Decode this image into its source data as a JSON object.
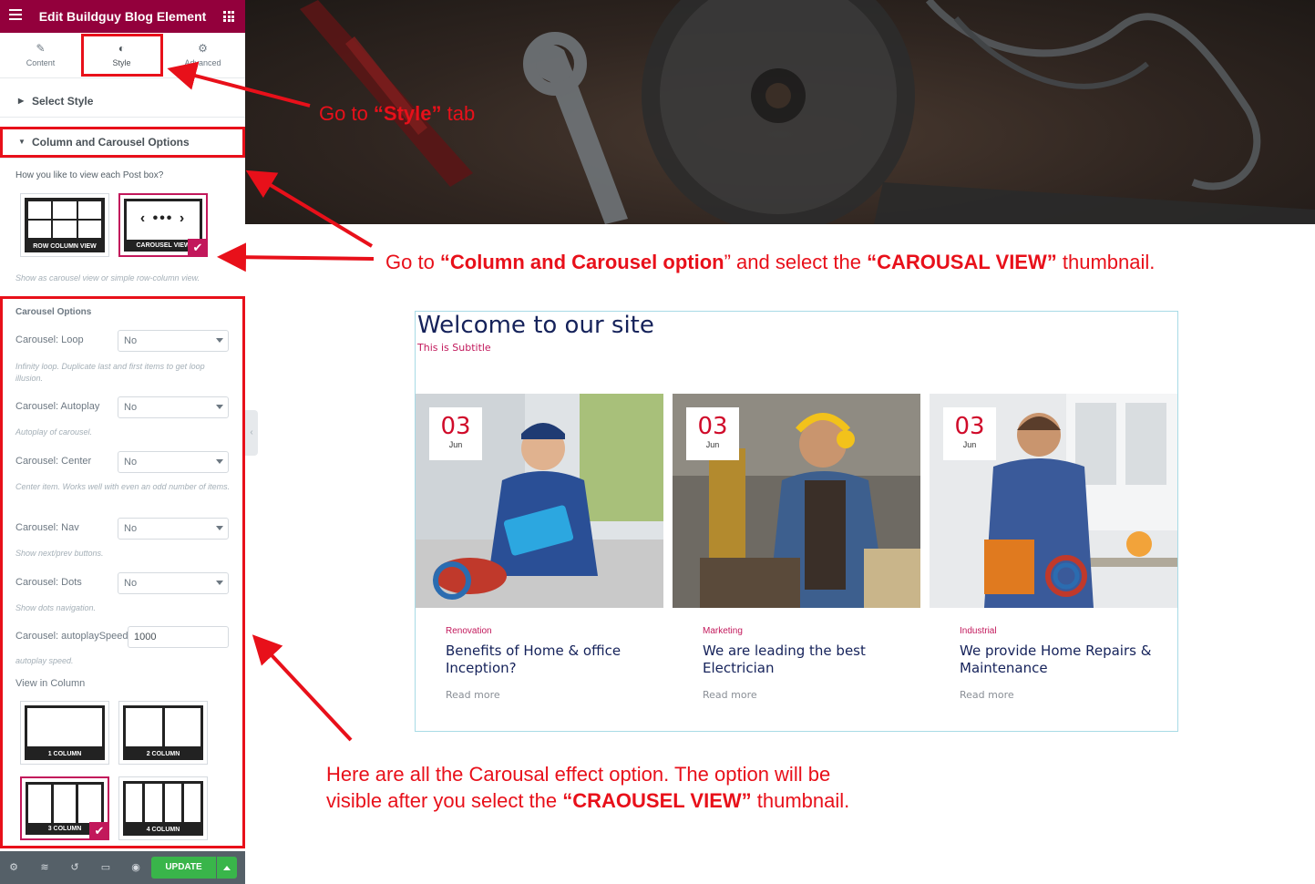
{
  "panel": {
    "title": "Edit Buildguy Blog Element",
    "tabs": [
      {
        "label": "Content",
        "icon": "pencil-icon"
      },
      {
        "label": "Style",
        "icon": "contrast-icon"
      },
      {
        "label": "Advanced",
        "icon": "gear-icon"
      }
    ],
    "active_tab": "Style",
    "sections": {
      "select_style": "Select Style",
      "column_carousel": "Column and Carousel Options"
    },
    "view_question": "How you like to view each Post box?",
    "view_options": [
      {
        "label": "ROW COLUMN VIEW",
        "selected": false
      },
      {
        "label": "CAROUSEL VIEW",
        "selected": true
      }
    ],
    "view_hint": "Show as carousel view or simple row-column view.",
    "carousel_heading": "Carousel Options",
    "controls": [
      {
        "label": "Carousel: Loop",
        "value": "No",
        "hint": "Infinity loop. Duplicate last and first items to get loop illusion."
      },
      {
        "label": "Carousel: Autoplay",
        "value": "No",
        "hint": "Autoplay of carousel."
      },
      {
        "label": "Carousel: Center",
        "value": "No",
        "hint": "Center item. Works well with even an odd number of items."
      },
      {
        "label": "Carousel: Nav",
        "value": "No",
        "hint": "Show next/prev buttons."
      },
      {
        "label": "Carousel: Dots",
        "value": "No",
        "hint": "Show dots navigation."
      }
    ],
    "autoplay_speed": {
      "label": "Carousel: autoplaySpeed",
      "value": "1000",
      "hint": "autoplay speed."
    },
    "view_in_column": "View in Column",
    "column_options": [
      {
        "label": "1 COLUMN",
        "selected": false
      },
      {
        "label": "2 COLUMN",
        "selected": false
      },
      {
        "label": "3 COLUMN",
        "selected": true
      },
      {
        "label": "4 COLUMN",
        "selected": false
      }
    ],
    "footer": {
      "icons": [
        "gear-icon",
        "layers-icon",
        "history-icon",
        "responsive-icon",
        "eye-icon"
      ],
      "update_label": "UPDATE"
    },
    "colors": {
      "header": "#93003c",
      "accent": "#c2185b",
      "update": "#39b54a"
    }
  },
  "annotations": {
    "style_tab": {
      "pre": "Go  to ",
      "bold": "“Style”",
      "post": " tab"
    },
    "column_option": {
      "pre": "Go to ",
      "bold1": "“Column and Carousel option",
      "mid": "” and select the ",
      "bold2": "“CAROUSAL VIEW”",
      "post": " thumbnail."
    },
    "options_line1": "Here are all the Carousal effect option. The option will be",
    "options_line2_pre": "visible after you select the ",
    "options_line2_bold": "“CRAOUSEL VIEW”",
    "options_line2_post": " thumbnail.",
    "color": "#e8101a"
  },
  "preview": {
    "title": "Welcome to our site",
    "subtitle": "This is Subtitle",
    "posts": [
      {
        "day": "03",
        "month": "Jun",
        "category": "Renovation",
        "title": "Benefits of Home & office Inception?",
        "read_more": "Read more"
      },
      {
        "day": "03",
        "month": "Jun",
        "category": "Marketing",
        "title": "We are leading the best Electrician",
        "read_more": "Read more"
      },
      {
        "day": "03",
        "month": "Jun",
        "category": "Industrial",
        "title": "We provide Home Repairs & Maintenance",
        "read_more": "Read more"
      }
    ]
  }
}
